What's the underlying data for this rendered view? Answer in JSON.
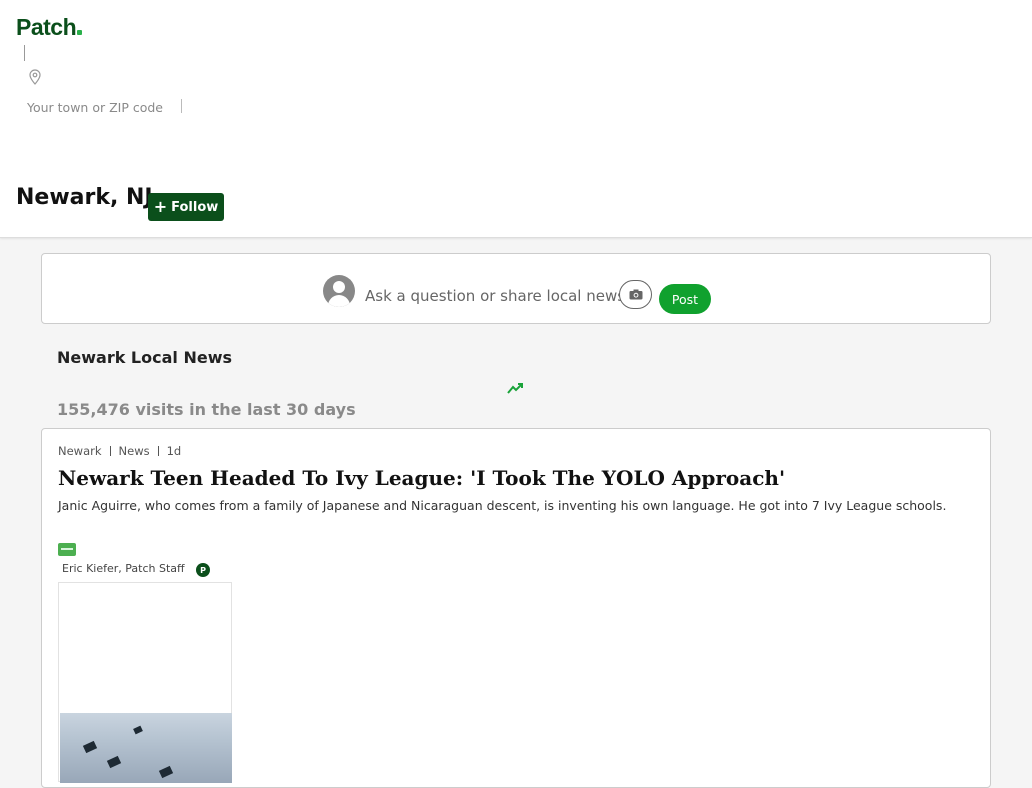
{
  "header": {
    "logo_text": "Patch",
    "town_search": {
      "placeholder": "Your town or ZIP code",
      "value": ""
    },
    "city_title": "Newark, NJ",
    "follow_label": "Follow"
  },
  "composer": {
    "prompt": "Ask a question or share local news",
    "post_label": "Post"
  },
  "local_news": {
    "title": "Newark Local News",
    "visits_text": "155,476 visits in the last 30 days"
  },
  "article": {
    "meta": [
      "Newark",
      "News",
      "1d"
    ],
    "title": "Newark Teen Headed To Ivy League: 'I Took The YOLO Approach'",
    "summary": "Janic Aguirre, who comes from a family of Japanese and Nicaraguan descent, is inventing his own language. He got into 7 Ivy League schools.",
    "author": "Eric Kiefer, Patch Staff",
    "author_badge": "P"
  },
  "colors": {
    "brand_dark_green": "#0b4f1b",
    "post_green": "#10a12e",
    "trend_green": "#1aa33a"
  },
  "icons": [
    "location-pin-icon",
    "plus-icon",
    "avatar-icon",
    "camera-icon",
    "trending-up-icon",
    "patch-badge-icon",
    "thumbnail-image"
  ]
}
